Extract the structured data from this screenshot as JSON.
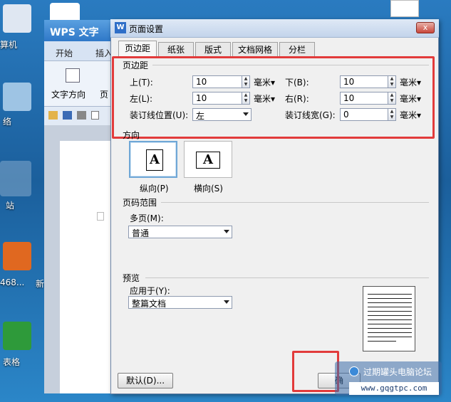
{
  "desktop": {
    "labels": [
      "算机",
      "络",
      "站",
      "468...",
      "新",
      "表格"
    ]
  },
  "wps": {
    "title": "WPS 文字",
    "logo": "W",
    "menu": [
      "开始",
      "插入"
    ],
    "ribbon_labels": [
      "文字方向",
      "页"
    ]
  },
  "dialog": {
    "logo": "W",
    "title": "页面设置",
    "close": "x",
    "tabs": [
      "页边距",
      "纸张",
      "版式",
      "文档网格",
      "分栏"
    ],
    "margins": {
      "group": "页边距",
      "top_label": "上(T):",
      "top_value": "10",
      "bottom_label": "下(B):",
      "bottom_value": "10",
      "left_label": "左(L):",
      "left_value": "10",
      "right_label": "右(R):",
      "right_value": "10",
      "gutter_pos_label": "装订线位置(U):",
      "gutter_pos_value": "左",
      "gutter_width_label": "装订线宽(G):",
      "gutter_width_value": "0",
      "unit": "毫米"
    },
    "orientation": {
      "group": "方向",
      "portrait": "纵向(P)",
      "landscape": "横向(S)",
      "glyph": "A"
    },
    "pages": {
      "group": "页码范围",
      "multi_label": "多页(M):",
      "multi_value": "普通"
    },
    "preview": {
      "group": "预览",
      "apply_label": "应用于(Y):",
      "apply_value": "整篇文档"
    },
    "default_button": "默认(D)...",
    "ok_button": "确"
  },
  "watermark": {
    "text": "过期罐头电脑论坛",
    "url": "www.gqgtpc.com"
  },
  "colors": {
    "highlight": "#e23b3b",
    "title_bar": "#2f78c8"
  }
}
